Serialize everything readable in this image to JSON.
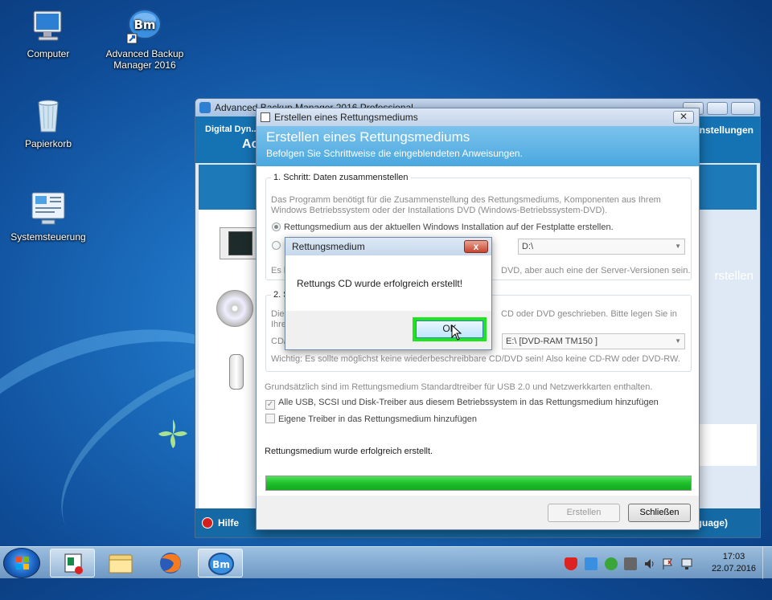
{
  "desktop": {
    "icons": [
      {
        "label": "Computer"
      },
      {
        "label": "Advanced Backup Manager 2016"
      },
      {
        "label": "Papierkorb"
      },
      {
        "label": "Systemsteuerung"
      }
    ]
  },
  "bg_window": {
    "title": "Advanced Backup Manager 2016 Professional",
    "brand": "Digital Dyn...",
    "brand_sub": "Ac",
    "settings_label": "nstellungen",
    "create_label": "rstellen",
    "help_label": "Hilfe",
    "language_label": "guage)"
  },
  "dialog": {
    "title": "Erstellen eines Rettungsmediums",
    "banner_title": "Erstellen eines Rettungsmediums",
    "banner_subtitle": "Befolgen Sie Schrittweise die eingeblendeten Anweisungen.",
    "step1": {
      "legend": "1. Schritt: Daten zusammenstellen",
      "desc_line1": "Das Programm benötigt für die Zusammenstellung des Rettungsmediums, Komponenten aus Ihrem",
      "desc_line2": "Windows Betriebssystem oder der Installations DVD (Windows-Betriebssystem-DVD).",
      "option1": "Rettungsmedium aus der aktuellen Windows Installation auf der Festplatte erstellen.",
      "drive_value": "D:\\",
      "note_start": "Es k",
      "note_end": "DVD, aber auch eine der Server-Versionen sein."
    },
    "step2": {
      "legend": "2. S",
      "line1_start": "Die",
      "line1_end": "CD oder DVD geschrieben. Bitte legen Sie in",
      "line2_start": "Ihre",
      "cd_label": "CD/",
      "drive_value": "E:\\ [DVD-RAM TM150   ]",
      "warning": "Wichtig: Es sollte möglichst keine wiederbeschreibbare CD/DVD sein! Also keine CD-RW oder DVD-RW."
    },
    "drivers_note": "Grundsätzlich sind im Rettungsmedium Standardtreiber für USB 2.0 und Netzwerkkarten enthalten.",
    "check1": "Alle USB, SCSI und Disk-Treiber aus diesem Betriebssystem in das Rettungsmedium hinzufügen",
    "check2": "Eigene Treiber in das Rettungsmedium hinzufügen",
    "status": "Rettungsmedium wurde erfolgreich erstellt.",
    "progress": 1.0,
    "create_button": "Erstellen",
    "close_button": "Schließen"
  },
  "message_box": {
    "title": "Rettungsmedium",
    "text": "Rettungs CD wurde erfolgreich erstellt!",
    "ok_button": "OK",
    "close_glyph": "x"
  },
  "taskbar": {
    "time": "17:03",
    "date": "22.07.2016"
  },
  "colors": {
    "accent_green": "#1ee61e",
    "progress_green": "#1fbf2b",
    "banner_blue": "#4aa7df"
  }
}
